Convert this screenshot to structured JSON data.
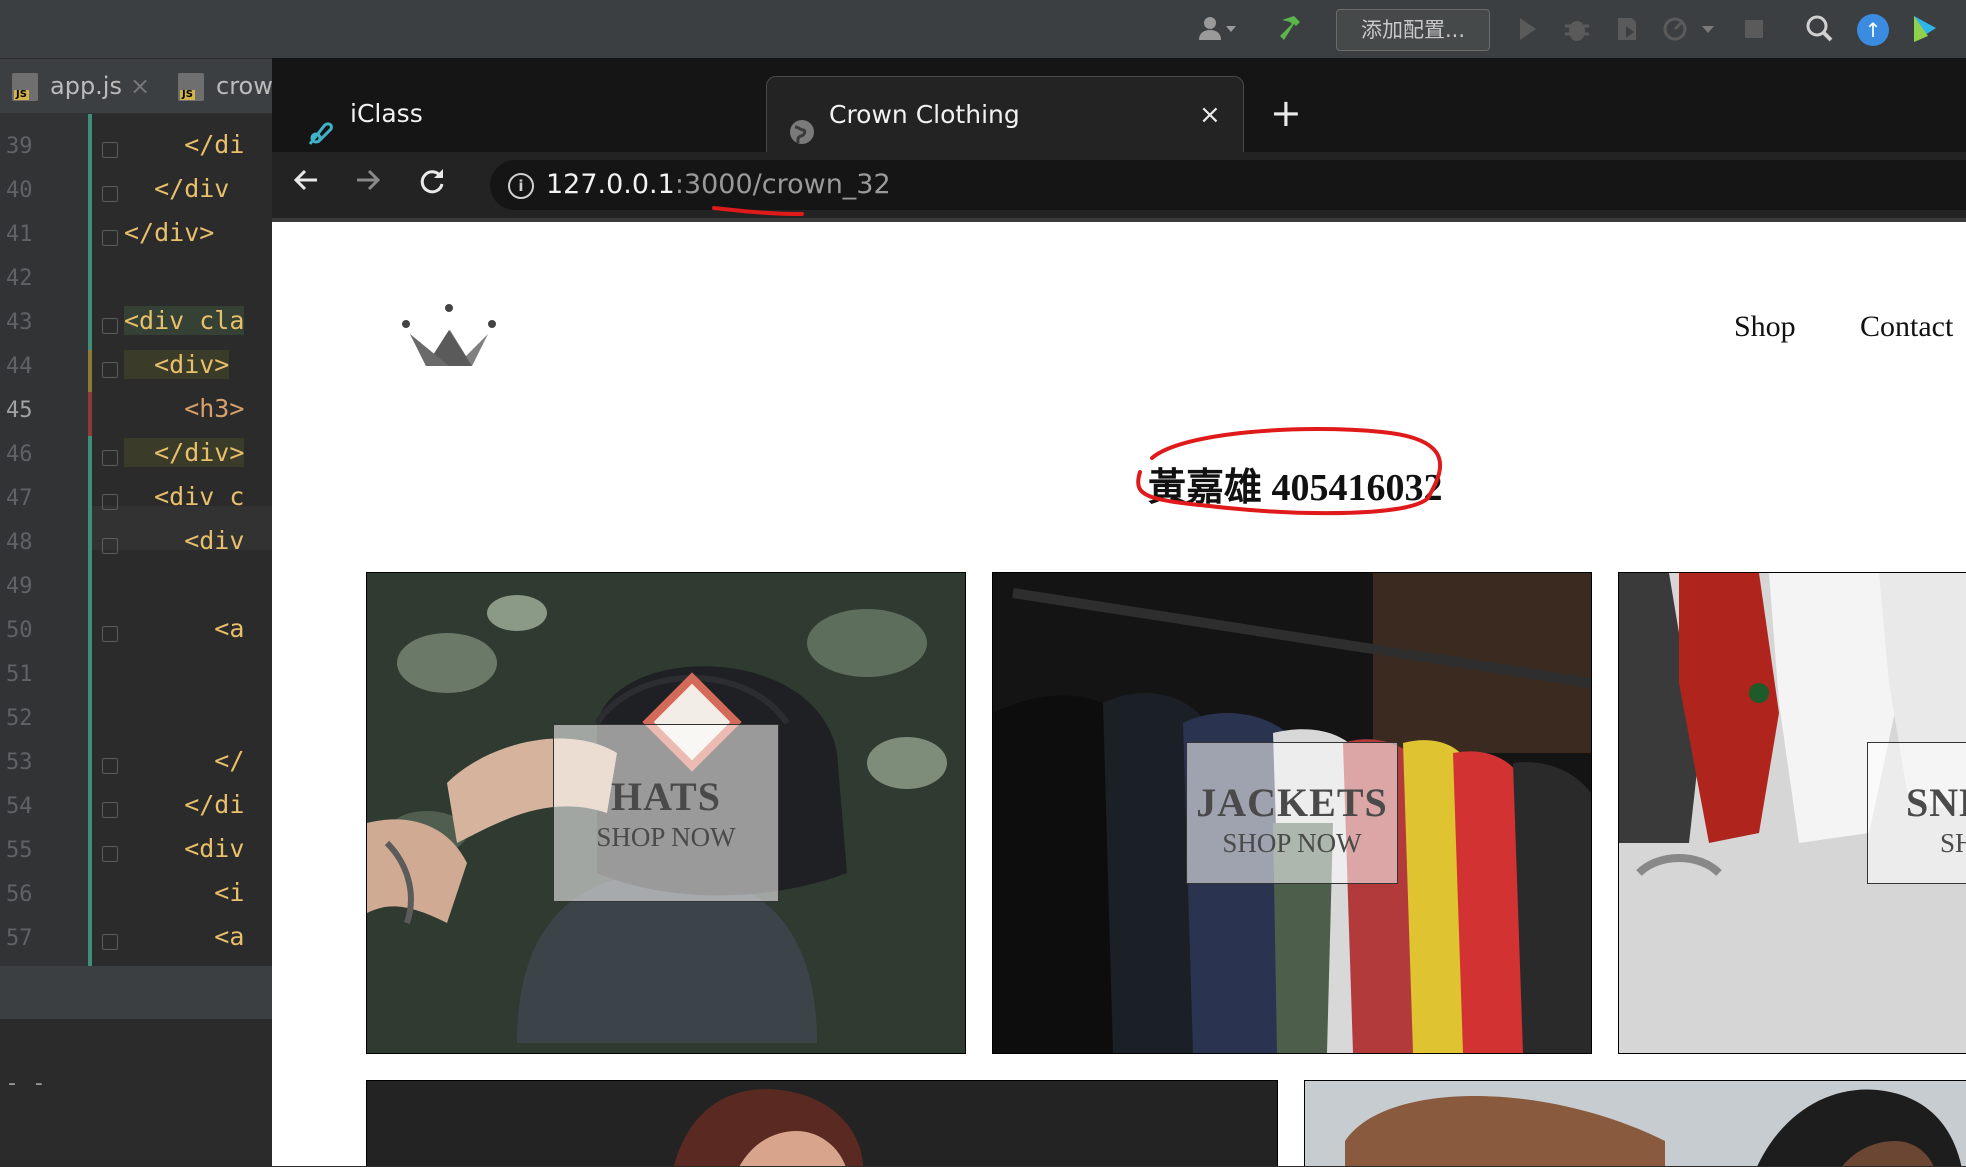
{
  "ide": {
    "toolbar": {
      "config_label": "添加配置..."
    },
    "file_tabs": [
      {
        "label": "app.js",
        "close": "×"
      },
      {
        "label": "crow"
      }
    ],
    "line_numbers": [
      "39",
      "40",
      "41",
      "42",
      "43",
      "44",
      "45",
      "46",
      "47",
      "48",
      "49",
      "50",
      "51",
      "52",
      "53",
      "54",
      "55",
      "56",
      "57"
    ],
    "code_lines": [
      "    </di",
      "  </div",
      "</div>",
      "",
      "<div cla",
      "  <div>",
      "    <h3>",
      "  </div>",
      "  <div c",
      "    <div",
      "",
      "      <a",
      "",
      "",
      "      </",
      "    </di",
      "    <div",
      "      <i",
      "      <a"
    ],
    "bottom_text": "- -"
  },
  "browser": {
    "tabs": [
      {
        "title": "iClass",
        "close": "×"
      },
      {
        "title": "Crown Clothing",
        "close": "×"
      }
    ],
    "new_tab": "+",
    "url": {
      "host": "127.0.0.1",
      "rest": ":3000/crown_32"
    }
  },
  "page": {
    "nav": {
      "shop": "Shop",
      "contact": "Contact"
    },
    "student_title": "黃嘉雄 405416032",
    "categories": [
      {
        "title": "HATS",
        "subtitle": "SHOP NOW"
      },
      {
        "title": "JACKETS",
        "subtitle": "SHOP NOW"
      },
      {
        "title": "SNEAKE",
        "subtitle": "SHOP NO"
      }
    ]
  },
  "colors": {
    "annotation_red": "#e01a1a",
    "ide_bg": "#2b2b2b",
    "ide_toolbar": "#3c3f41"
  }
}
